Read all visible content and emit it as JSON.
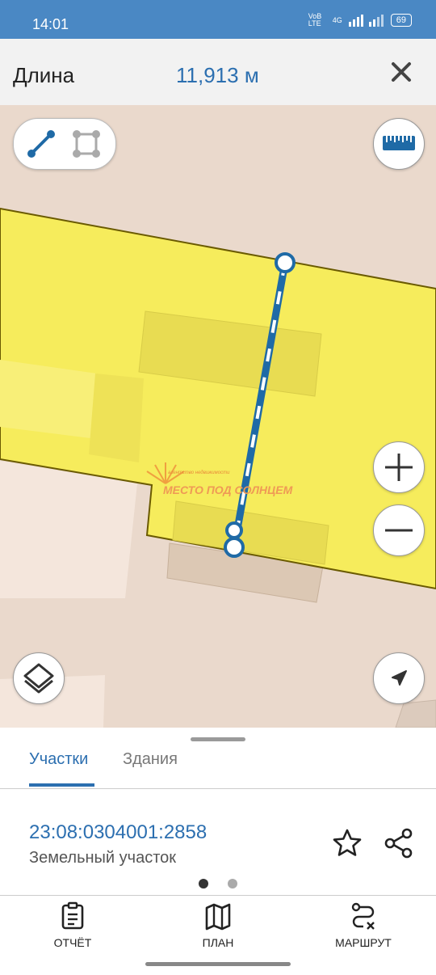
{
  "status_bar": {
    "time": "14:01",
    "network": "4G",
    "battery": "69",
    "operator": "VoB LTE"
  },
  "measure_bar": {
    "label": "Длина",
    "value": "11,913 м"
  },
  "map": {
    "watermark_small": "агентство недвижимости",
    "watermark_big": "МЕСТО ПОД СОЛНЦЕМ",
    "colors": {
      "parcel_fill": "#f6ec5c",
      "parcel_border": "#6a5a00",
      "measure_line": "#1f6aa6",
      "map_background": "#ead9cc"
    }
  },
  "controls": {
    "mode_line": "line-measure-icon",
    "mode_area": "area-measure-icon",
    "ruler": "ruler-icon",
    "zoom_in": "plus-icon",
    "zoom_out": "minus-icon",
    "layers": "layers-icon",
    "location": "navigation-arrow-icon"
  },
  "tabs": [
    {
      "label": "Участки",
      "active": true
    },
    {
      "label": "Здания",
      "active": false
    }
  ],
  "parcel": {
    "cadastral_number": "23:08:0304001:2858",
    "type": "Земельный участок"
  },
  "pager": {
    "active_index": 0,
    "count": 2
  },
  "bottom_nav": [
    {
      "label": "ОТЧЁТ",
      "icon": "report-icon"
    },
    {
      "label": "ПЛАН",
      "icon": "map-icon"
    },
    {
      "label": "МАРШРУТ",
      "icon": "route-icon"
    }
  ]
}
